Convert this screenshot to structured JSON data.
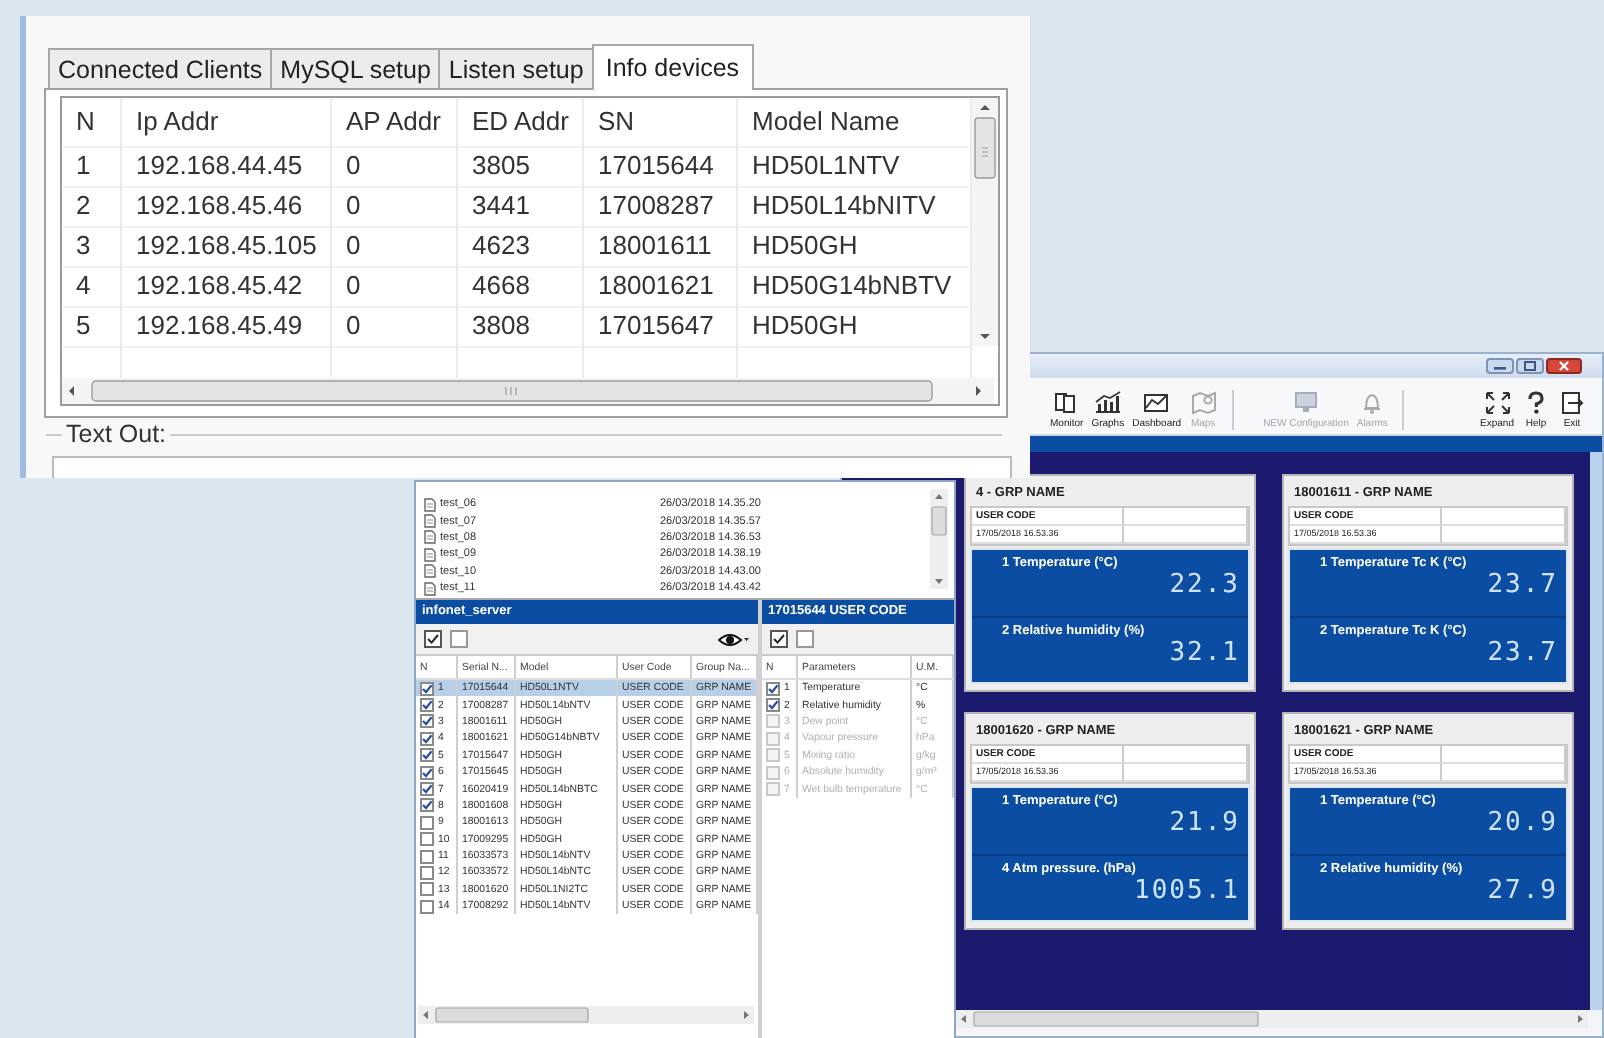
{
  "app_window": {
    "toolbar": [
      {
        "label": "Monitor",
        "disabled": false
      },
      {
        "label": "Graphs",
        "disabled": false
      },
      {
        "label": "Dashboard",
        "disabled": false
      },
      {
        "label": "Maps",
        "disabled": true
      },
      {
        "label": "NEW Configuration",
        "disabled": true
      },
      {
        "label": "Alarms",
        "disabled": true
      },
      {
        "label": "Expand",
        "disabled": false
      },
      {
        "label": "Help",
        "disabled": false
      },
      {
        "label": "Exit",
        "disabled": false
      }
    ],
    "cards": [
      {
        "title": "4 - GRP NAME",
        "user_code": "USER CODE",
        "timestamp": "17/05/2018 16.53.36",
        "readings": [
          {
            "label": "1 Temperature (°C)",
            "value": "22.3"
          },
          {
            "label": "2 Relative humidity (%)",
            "value": "32.1"
          }
        ]
      },
      {
        "title": "18001611 - GRP NAME",
        "user_code": "USER CODE",
        "timestamp": "17/05/2018 16.53.36",
        "readings": [
          {
            "label": "1 Temperature Tc K (°C)",
            "value": "23.7"
          },
          {
            "label": "2 Temperature Tc K (°C)",
            "value": "23.7"
          }
        ]
      },
      {
        "title": "18001620 - GRP NAME",
        "user_code": "USER CODE",
        "timestamp": "17/05/2018 16.53.36",
        "readings": [
          {
            "label": "1 Temperature (°C)",
            "value": "21.9"
          },
          {
            "label": "4 Atm pressure. (hPa)",
            "value": "1005.1"
          }
        ]
      },
      {
        "title": "18001621 - GRP NAME",
        "user_code": "USER CODE",
        "timestamp": "17/05/2018 16.53.36",
        "readings": [
          {
            "label": "1 Temperature (°C)",
            "value": "20.9"
          },
          {
            "label": "2 Relative humidity (%)",
            "value": "27.9"
          }
        ]
      }
    ]
  },
  "server_window": {
    "files": [
      {
        "name": "test_06",
        "date": "26/03/2018 14.35.20"
      },
      {
        "name": "test_07",
        "date": "26/03/2018 14.35.57"
      },
      {
        "name": "test_08",
        "date": "26/03/2018 14.36.53"
      },
      {
        "name": "test_09",
        "date": "26/03/2018 14.38.19"
      },
      {
        "name": "test_10",
        "date": "26/03/2018 14.43.00"
      },
      {
        "name": "test_11",
        "date": "26/03/2018 14.43.42"
      }
    ],
    "devices_panel": {
      "title": "infonet_server",
      "columns": [
        "N",
        "Serial N...",
        "Model",
        "User Code",
        "Group Na..."
      ],
      "rows": [
        {
          "checked": true,
          "selected": true,
          "cells": [
            "1",
            "17015644",
            "HD50L1NTV",
            "USER CODE",
            "GRP NAME"
          ]
        },
        {
          "checked": true,
          "selected": false,
          "cells": [
            "2",
            "17008287",
            "HD50L14bNTV",
            "USER CODE",
            "GRP NAME"
          ]
        },
        {
          "checked": true,
          "selected": false,
          "cells": [
            "3",
            "18001611",
            "HD50GH",
            "USER CODE",
            "GRP NAME"
          ]
        },
        {
          "checked": true,
          "selected": false,
          "cells": [
            "4",
            "18001621",
            "HD50G14bNBTV",
            "USER CODE",
            "GRP NAME"
          ]
        },
        {
          "checked": true,
          "selected": false,
          "cells": [
            "5",
            "17015647",
            "HD50GH",
            "USER CODE",
            "GRP NAME"
          ]
        },
        {
          "checked": true,
          "selected": false,
          "cells": [
            "6",
            "17015645",
            "HD50GH",
            "USER CODE",
            "GRP NAME"
          ]
        },
        {
          "checked": true,
          "selected": false,
          "cells": [
            "7",
            "16020419",
            "HD50L14bNBTC",
            "USER CODE",
            "GRP NAME"
          ]
        },
        {
          "checked": true,
          "selected": false,
          "cells": [
            "8",
            "18001608",
            "HD50GH",
            "USER CODE",
            "GRP NAME"
          ]
        },
        {
          "checked": false,
          "selected": false,
          "cells": [
            "9",
            "18001613",
            "HD50GH",
            "USER CODE",
            "GRP NAME"
          ]
        },
        {
          "checked": false,
          "selected": false,
          "cells": [
            "10",
            "17009295",
            "HD50GH",
            "USER CODE",
            "GRP NAME"
          ]
        },
        {
          "checked": false,
          "selected": false,
          "cells": [
            "11",
            "16033573",
            "HD50L14bNTV",
            "USER CODE",
            "GRP NAME"
          ]
        },
        {
          "checked": false,
          "selected": false,
          "cells": [
            "12",
            "16033572",
            "HD50L14bNTC",
            "USER CODE",
            "GRP NAME"
          ]
        },
        {
          "checked": false,
          "selected": false,
          "cells": [
            "13",
            "18001620",
            "HD50L1NI2TC",
            "USER CODE",
            "GRP NAME"
          ]
        },
        {
          "checked": false,
          "selected": false,
          "cells": [
            "14",
            "17008292",
            "HD50L14bNTV",
            "USER CODE",
            "GRP NAME"
          ]
        }
      ]
    },
    "params_panel": {
      "title": "17015644 USER CODE",
      "columns": [
        "N",
        "Parameters",
        "U.M."
      ],
      "rows": [
        {
          "checked": true,
          "disabled": false,
          "cells": [
            "1",
            "Temperature",
            "°C"
          ]
        },
        {
          "checked": true,
          "disabled": false,
          "cells": [
            "2",
            "Relative humidity",
            "%"
          ]
        },
        {
          "checked": false,
          "disabled": true,
          "cells": [
            "3",
            "Dew point",
            "°C"
          ]
        },
        {
          "checked": false,
          "disabled": true,
          "cells": [
            "4",
            "Vapour pressure",
            "hPa"
          ]
        },
        {
          "checked": false,
          "disabled": true,
          "cells": [
            "5",
            "Mixing ratio",
            "g/kg"
          ]
        },
        {
          "checked": false,
          "disabled": true,
          "cells": [
            "6",
            "Absolute humidity",
            "g/m³"
          ]
        },
        {
          "checked": false,
          "disabled": true,
          "cells": [
            "7",
            "Wet bulb temperature",
            "°C"
          ]
        }
      ]
    }
  },
  "info_window": {
    "tabs": [
      {
        "label": "Connected Clients",
        "selected": false
      },
      {
        "label": "MySQL setup",
        "selected": false
      },
      {
        "label": "Listen setup",
        "selected": false
      },
      {
        "label": "Info devices",
        "selected": true
      }
    ],
    "table": {
      "columns": [
        "N",
        "Ip Addr",
        "AP Addr",
        "ED Addr",
        "SN",
        "Model Name"
      ],
      "rows": [
        [
          "1",
          "192.168.44.45",
          "0",
          "3805",
          "17015644",
          "HD50L1NTV"
        ],
        [
          "2",
          "192.168.45.46",
          "0",
          "3441",
          "17008287",
          "HD50L14bNITV"
        ],
        [
          "3",
          "192.168.45.105",
          "0",
          "4623",
          "18001611",
          "HD50GH"
        ],
        [
          "4",
          "192.168.45.42",
          "0",
          "4668",
          "18001621",
          "HD50G14bNBTV"
        ],
        [
          "5",
          "192.168.45.49",
          "0",
          "3808",
          "17015647",
          "HD50GH"
        ]
      ]
    },
    "text_out": {
      "label": "Text Out:"
    }
  }
}
